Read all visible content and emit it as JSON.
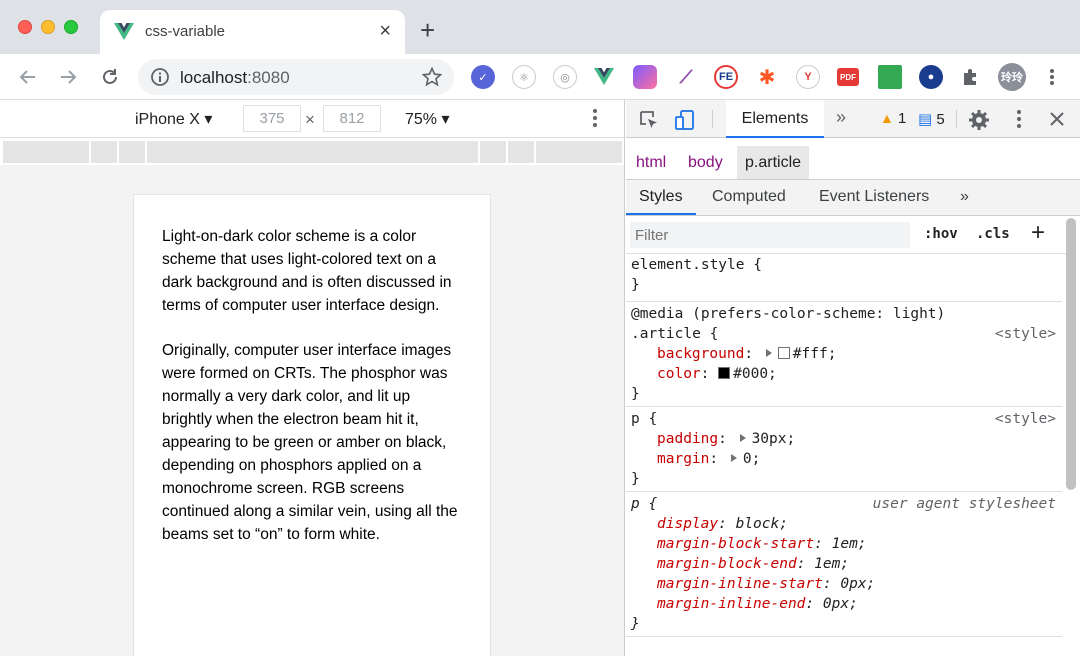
{
  "tab": {
    "title": "css-variable",
    "close": "×"
  },
  "newtab": "+",
  "omnibox": {
    "host": "localhost",
    "port": ":8080"
  },
  "extensions": {
    "fe_label": "FE",
    "pdf_label": "PDF",
    "avatar_label": "玲玲"
  },
  "device_bar": {
    "device": "iPhone X ▾",
    "width": "375",
    "height": "812",
    "times": "×",
    "zoom": "75% ▾"
  },
  "article": {
    "p1": "Light-on-dark color scheme is a color scheme that uses light-colored text on a dark background and is often discussed in terms of computer user interface design.",
    "p2": "Originally, computer user interface images were formed on CRTs. The phosphor was normally a very dark color, and lit up brightly when the electron beam hit it, appearing to be green or amber on black, depending on phosphors applied on a monochrome screen. RGB screens continued along a similar vein, using all the beams set to “on” to form white."
  },
  "devtools": {
    "tab_elements": "Elements",
    "more": "»",
    "warn_count": "1",
    "msg_count": "5",
    "breadcrumb": [
      "html",
      "body",
      "p.article"
    ],
    "subtabs": [
      "Styles",
      "Computed",
      "Event Listeners",
      "»"
    ],
    "filter_placeholder": "Filter",
    "hov": ":hov",
    "cls": ".cls",
    "plus": "+",
    "rules": {
      "element_style": {
        "selector": "element.style {",
        "close": "}"
      },
      "media": {
        "media": "@media (prefers-color-scheme: light)",
        "selector": ".article {",
        "source": "<style>",
        "bg_name": "background",
        "bg_value": "#fff;",
        "color_name": "color",
        "color_value": "#000;",
        "close": "}"
      },
      "p_rule": {
        "selector": "p {",
        "source": "<style>",
        "padding_name": "padding",
        "padding_value": "30px;",
        "margin_name": "margin",
        "margin_value": "0;",
        "close": "}"
      },
      "ua_rule": {
        "selector": "p {",
        "source": "user agent stylesheet",
        "props": [
          {
            "name": "display",
            "value": "block;"
          },
          {
            "name": "margin-block-start",
            "value": "1em;"
          },
          {
            "name": "margin-block-end",
            "value": "1em;"
          },
          {
            "name": "margin-inline-start",
            "value": "0px;"
          },
          {
            "name": "margin-inline-end",
            "value": "0px;"
          }
        ],
        "close": "}"
      }
    }
  },
  "colors": {
    "accent": "#1a73e8",
    "property": "#c80000",
    "tag": "#881280",
    "swatch_bg": "#fff",
    "swatch_color": "#000"
  }
}
